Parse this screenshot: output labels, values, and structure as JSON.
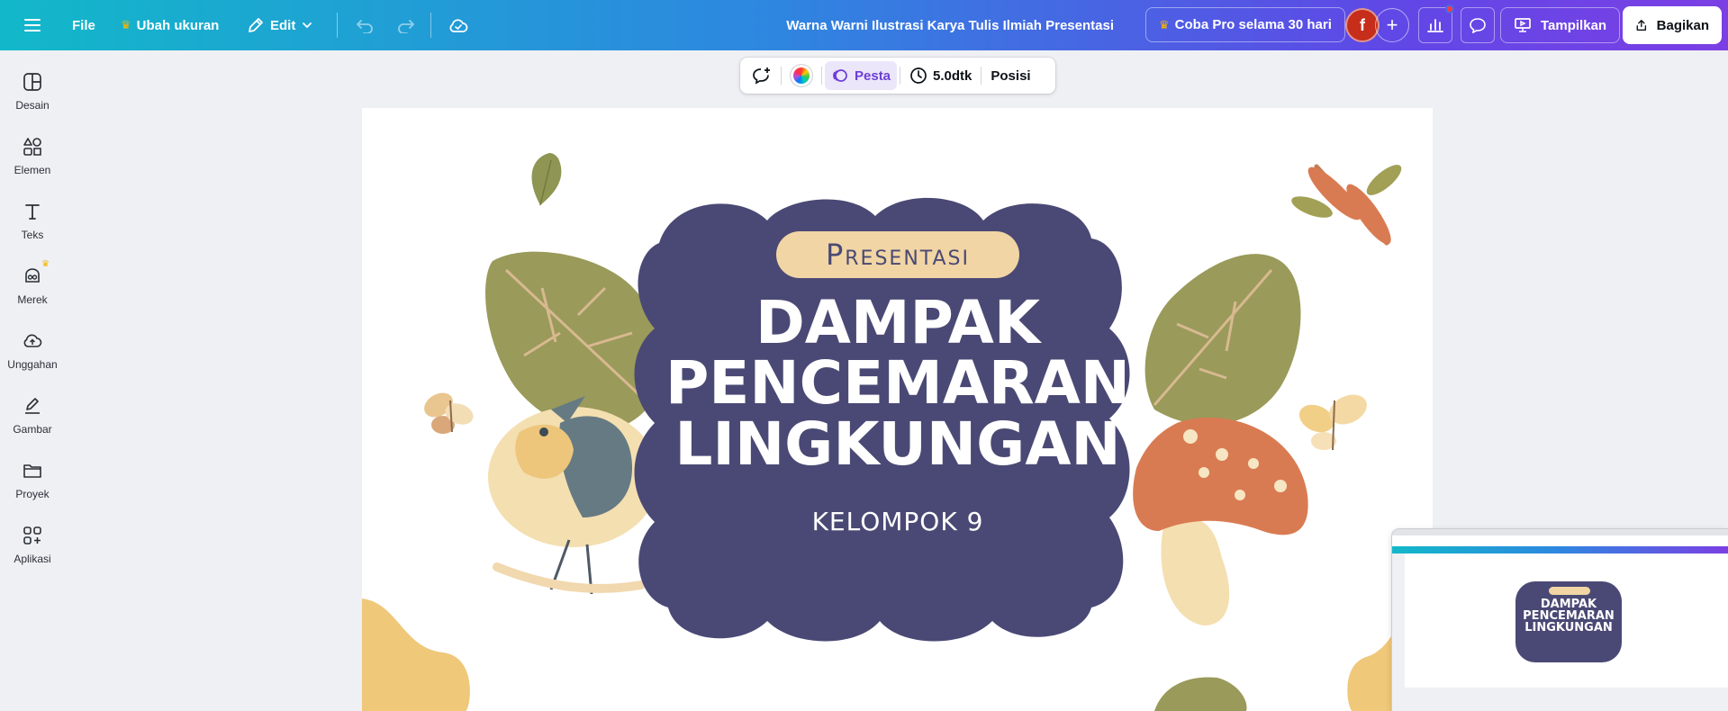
{
  "topbar": {
    "file_label": "File",
    "resize_label": "Ubah ukuran",
    "edit_label": "Edit",
    "doc_title": "Warna Warni Ilustrasi Karya Tulis Ilmiah Presentasi",
    "pro_label": "Coba Pro selama 30 hari",
    "avatar_initial": "f",
    "present_label": "Tampilkan",
    "share_label": "Bagikan"
  },
  "sidebar": {
    "items": [
      {
        "label": "Desain",
        "icon": "layout-icon"
      },
      {
        "label": "Elemen",
        "icon": "shapes-icon"
      },
      {
        "label": "Teks",
        "icon": "text-icon"
      },
      {
        "label": "Merek",
        "icon": "brand-icon"
      },
      {
        "label": "Unggahan",
        "icon": "cloud-upload-icon"
      },
      {
        "label": "Gambar",
        "icon": "draw-icon"
      },
      {
        "label": "Proyek",
        "icon": "folder-icon"
      },
      {
        "label": "Aplikasi",
        "icon": "apps-icon"
      }
    ]
  },
  "float_toolbar": {
    "animate_label": "Pesta",
    "duration_label": "5.0dtk",
    "position_label": "Posisi"
  },
  "slide": {
    "pill_text": "Presentasi",
    "title_line1": "DAMPAK",
    "title_line2": "PENCEMARAN",
    "title_line3": "LINGKUNGAN",
    "subtitle": "KELOMPOK 9"
  },
  "preview": {
    "title_line1": "DAMPAK",
    "title_line2": "PENCEMARAN",
    "title_line3": "LINGKUNGAN"
  },
  "colors": {
    "blob": "#4a4975",
    "pill": "#f1d5a4",
    "leaf": "#9a9a5a",
    "mushroom": "#d97b52",
    "accent_gradient_start": "#12b8c9",
    "accent_gradient_end": "#7b3fe4"
  }
}
